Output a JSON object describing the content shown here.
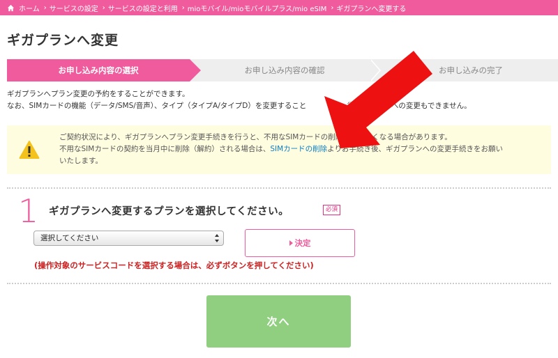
{
  "breadcrumb": {
    "items": [
      "ホーム",
      "サービスの設定",
      "サービスの設定と利用",
      "mioモバイル/mioモバイルプラス/mio eSIM",
      "ギガプランへ変更する"
    ]
  },
  "page": {
    "title": "ギガプランへ変更"
  },
  "steps": [
    {
      "label": "お申し込み内容の選択",
      "active": true
    },
    {
      "label": "お申し込み内容の確認",
      "active": false
    },
    {
      "label": "お申し込みの完了",
      "active": false
    }
  ],
  "intro": {
    "line1": "ギガプランへプラン変更の予約をすることができます。",
    "line2_part1": "なお、SIMカードの機能（データ/SMS/音声）、タイプ（タイプA/タイプD）を変更すること",
    "line2_part2": "、従量制プランへの変更もできません。"
  },
  "warning": {
    "line1": "ご契約状況により、ギガプランへプラン変更手続きを行うと、不用なSIMカードの削除ができなくなる場合があります。",
    "line2_before": "不用なSIMカードの契約を当月中に削除（解約）される場合は、",
    "line2_link": "SIMカードの削除",
    "line2_after": "よりお手続き後、ギガプランへの変更手続きをお願い",
    "line3": "いたします。"
  },
  "section": {
    "number": "1",
    "title": "ギガプランへ変更するプランを選択してください。",
    "required": "必須"
  },
  "form": {
    "select_value": "選択してください",
    "decide_label": "決定",
    "note": "(操作対象のサービスコードを選択する場合は、必ずボタンを押してください)"
  },
  "next": {
    "label": "次へ"
  },
  "colors": {
    "brand_pink": "#ef5b9c",
    "next_green": "#8fcf7f",
    "warning_bg": "#fffde0",
    "note_red": "#cc2222",
    "link_blue": "#0a7ec2",
    "annotation_arrow": "#ee1111"
  },
  "icons": {
    "home": "home-icon",
    "warning": "warning-icon",
    "select": "select-arrows-icon",
    "arrow": "annotation-arrow"
  }
}
